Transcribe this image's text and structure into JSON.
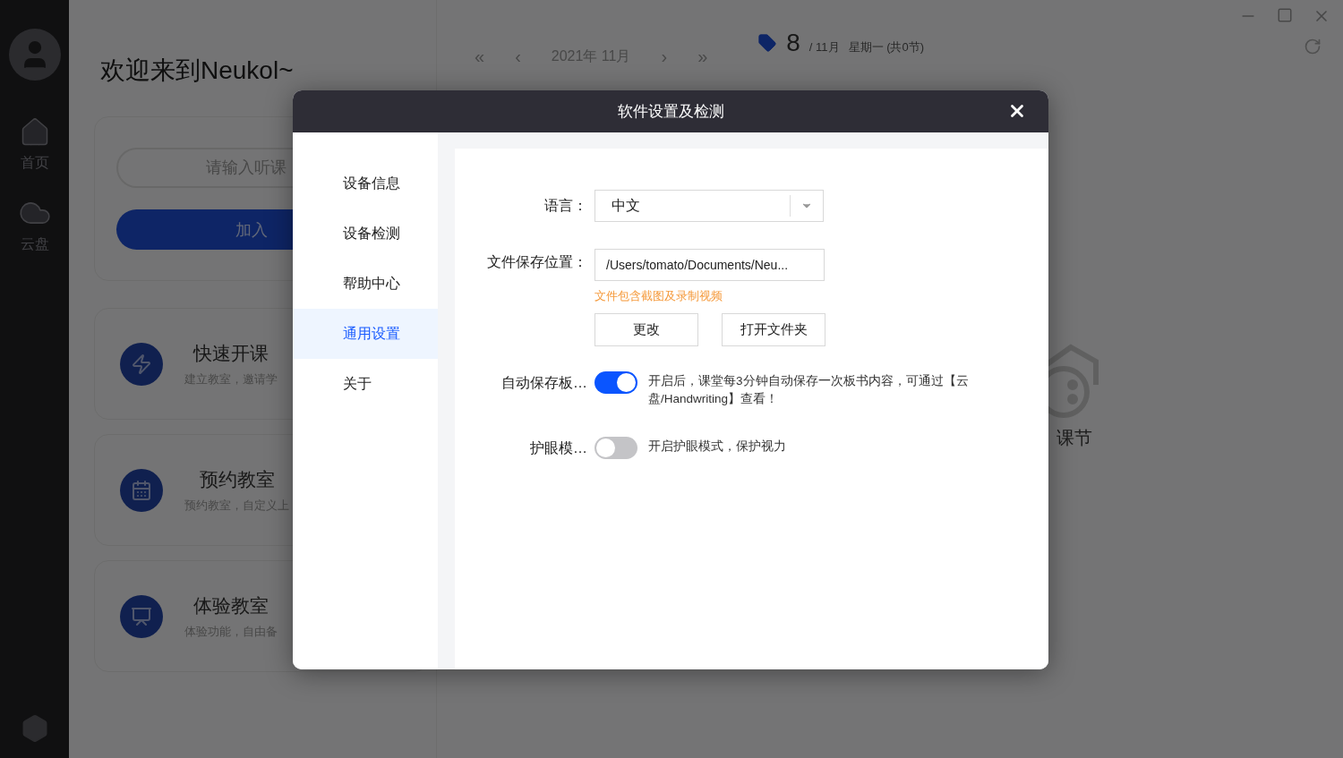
{
  "sidebar": {
    "items": [
      {
        "kind": "home",
        "label": "首页"
      },
      {
        "kind": "cloud",
        "label": "云盘"
      }
    ]
  },
  "welcome": "欢迎来到Neukol~",
  "join_card": {
    "placeholder": "请输入听课",
    "button": "加入"
  },
  "action_cards": [
    {
      "kind": "quick",
      "title": "快速开课",
      "subtitle": "建立教室，邀请学"
    },
    {
      "kind": "schedule",
      "title": "预约教室",
      "subtitle": "预约教室，自定义上"
    },
    {
      "kind": "trial",
      "title": "体验教室",
      "subtitle": "体验功能，自由备"
    }
  ],
  "calendar": {
    "nav": [
      "«",
      "‹",
      "2021年 11月",
      "›",
      "»"
    ],
    "day": "8",
    "month": "/ 11月",
    "weekday": "星期一 (共0节)",
    "empty_text": "课节"
  },
  "dialog": {
    "title": "软件设置及检测",
    "nav": [
      {
        "label": "设备信息",
        "selected": false
      },
      {
        "label": "设备检测",
        "selected": false
      },
      {
        "label": "帮助中心",
        "selected": false
      },
      {
        "label": "通用设置",
        "selected": true
      },
      {
        "label": "关于",
        "selected": false
      }
    ],
    "language": {
      "label": "语言：",
      "value": "中文"
    },
    "save_location": {
      "label": "文件保存位置：",
      "value": "/Users/tomato/Documents/Neu...",
      "hint": "文件包含截图及录制视频",
      "buttons": [
        "更改",
        "打开文件夹"
      ]
    },
    "toggles": [
      {
        "label": "自动保存板…",
        "on": true,
        "description": "开启后，课堂每3分钟自动保存一次板书内容，可通过【云盘/Handwriting】查看！"
      },
      {
        "label": "护眼模…",
        "on": false,
        "description": "开启护眼模式，保护视力"
      }
    ]
  }
}
